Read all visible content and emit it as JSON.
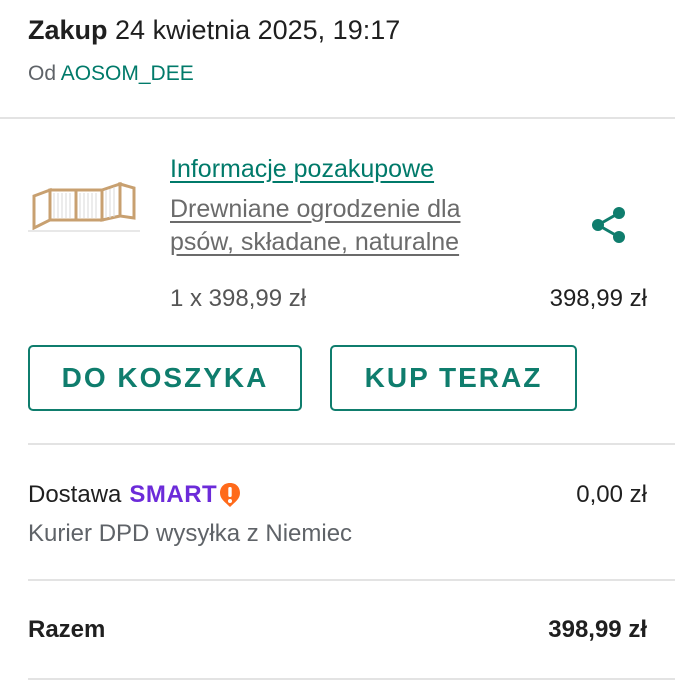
{
  "header": {
    "title": "Zakup",
    "date": "24 kwietnia 2025, 19:17",
    "seller_prefix": "Od",
    "seller_name": "AOSOM_DEE"
  },
  "item": {
    "info_link": "Informacje pozakupowe",
    "title": "Drewniane ogrodzenie dla psów, składane, naturalne",
    "quantity_price": "1 x 398,99 zł",
    "line_total": "398,99 zł",
    "image_icon": "wooden-fence-image",
    "share_icon": "share-icon"
  },
  "actions": {
    "add_to_cart": "DO KOSZYKA",
    "buy_now": "KUP TERAZ"
  },
  "shipping": {
    "label": "Dostawa",
    "smart_logo": "SMART",
    "price": "0,00 zł",
    "method": "Kurier DPD wysyłka z Niemiec"
  },
  "summary": {
    "total_label": "Razem",
    "total_value": "398,99 zł"
  },
  "colors": {
    "accent": "#0f7d6d",
    "smart_purple": "#6c2bd9",
    "smart_orange": "#ff6a1a"
  }
}
